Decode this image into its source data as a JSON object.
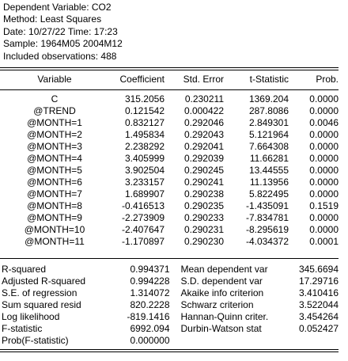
{
  "header": {
    "dependent_variable": "Dependent Variable: CO2",
    "method": "Method: Least Squares",
    "date": "Date: 10/27/22   Time: 17:23",
    "sample": "Sample: 1964M05 2004M12",
    "observations": "Included observations: 488"
  },
  "columns": [
    "Variable",
    "Coefficient",
    "Std. Error",
    "t-Statistic",
    "Prob."
  ],
  "rows": [
    [
      "C",
      "315.2056",
      "0.230211",
      "1369.204",
      "0.0000"
    ],
    [
      "@TREND",
      "0.121542",
      "0.000422",
      "287.8086",
      "0.0000"
    ],
    [
      "@MONTH=1",
      "0.832127",
      "0.292046",
      "2.849301",
      "0.0046"
    ],
    [
      "@MONTH=2",
      "1.495834",
      "0.292043",
      "5.121964",
      "0.0000"
    ],
    [
      "@MONTH=3",
      "2.238292",
      "0.292041",
      "7.664308",
      "0.0000"
    ],
    [
      "@MONTH=4",
      "3.405999",
      "0.292039",
      "11.66281",
      "0.0000"
    ],
    [
      "@MONTH=5",
      "3.902504",
      "0.290245",
      "13.44555",
      "0.0000"
    ],
    [
      "@MONTH=6",
      "3.233157",
      "0.290241",
      "11.13956",
      "0.0000"
    ],
    [
      "@MONTH=7",
      "1.689907",
      "0.290238",
      "5.822495",
      "0.0000"
    ],
    [
      "@MONTH=8",
      "-0.416513",
      "0.290235",
      "-1.435091",
      "0.1519"
    ],
    [
      "@MONTH=9",
      "-2.273909",
      "0.290233",
      "-7.834781",
      "0.0000"
    ],
    [
      "@MONTH=10",
      "-2.407647",
      "0.290231",
      "-8.295619",
      "0.0000"
    ],
    [
      "@MONTH=11",
      "-1.170897",
      "0.290230",
      "-4.034372",
      "0.0001"
    ]
  ],
  "stats": [
    [
      "R-squared",
      "0.994371",
      "Mean dependent var",
      "345.6694"
    ],
    [
      "Adjusted R-squared",
      "0.994228",
      "S.D. dependent var",
      "17.29716"
    ],
    [
      "S.E. of regression",
      "1.314072",
      "Akaike info criterion",
      "3.410416"
    ],
    [
      "Sum squared resid",
      "820.2228",
      "Schwarz criterion",
      "3.522044"
    ],
    [
      "Log likelihood",
      "-819.1416",
      "Hannan-Quinn criter.",
      "3.454264"
    ],
    [
      "F-statistic",
      "6992.094",
      "Durbin-Watson stat",
      "0.052427"
    ],
    [
      "Prob(F-statistic)",
      "0.000000",
      "",
      ""
    ]
  ]
}
